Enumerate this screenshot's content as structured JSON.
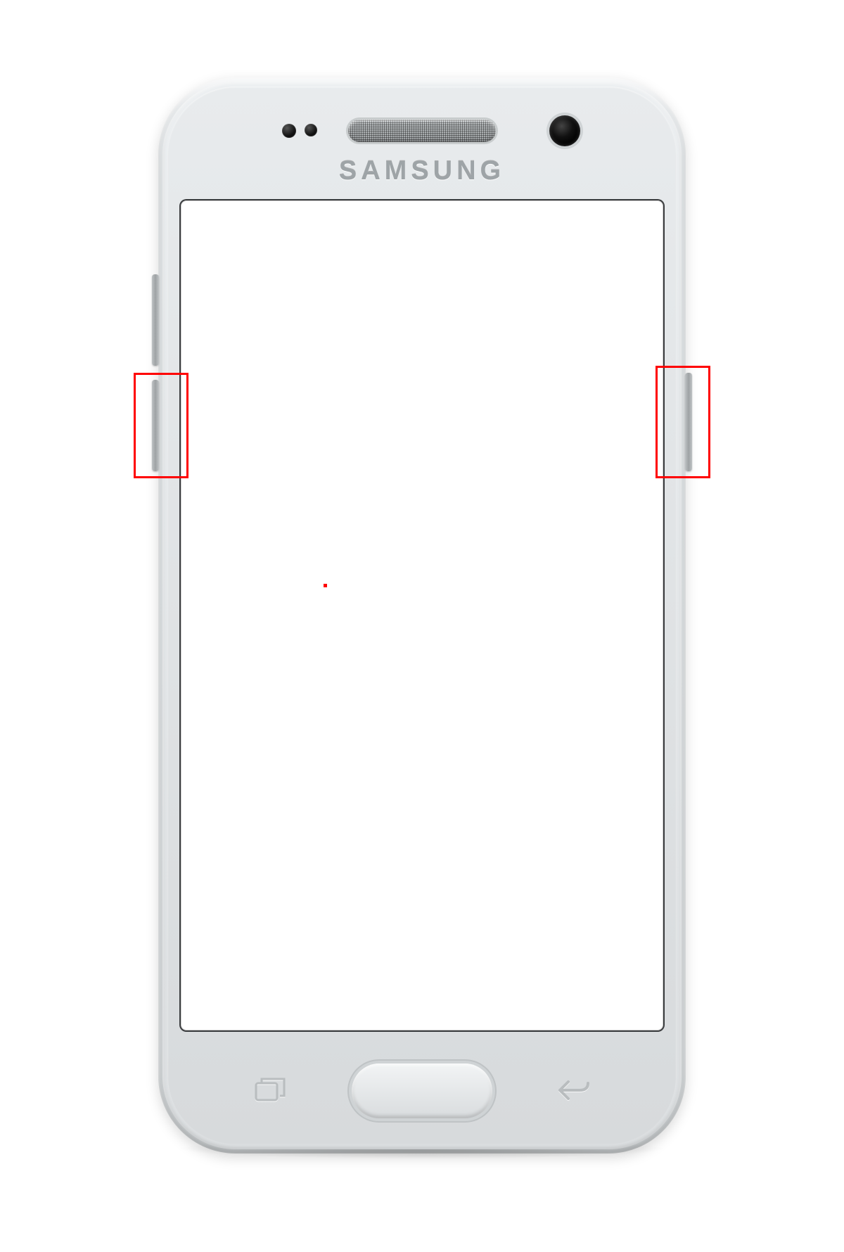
{
  "device": {
    "brand": "SAMSUNG"
  },
  "annotations": {
    "left_highlight": "volume-down-button",
    "right_highlight": "power-button"
  },
  "colors": {
    "highlight": "#ff0000",
    "body_silver": "#d9dddf"
  }
}
